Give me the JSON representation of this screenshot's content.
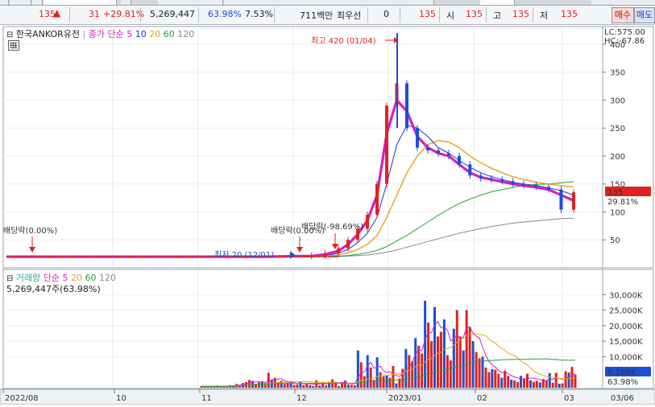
{
  "quote": {
    "price": "135",
    "change": "31",
    "change_pct": "+29.81%",
    "volume": "5,269,447",
    "volume_ratio": "63.98%",
    "turnover": "7.53%",
    "trade_value": "711백만",
    "best_bid_label": "최우선",
    "best_bid": "0",
    "ask_price": "135",
    "open_label": "시",
    "open": "135",
    "high_label": "고",
    "high": "135",
    "low_label": "저",
    "low": "135",
    "buy_label": "매수",
    "sell_label": "매도"
  },
  "price_panel": {
    "stock_name": "한국ANKOR유전",
    "ma_label": "종가 단순",
    "ma_periods": [
      "5",
      "10",
      "20",
      "60",
      "120"
    ],
    "lc": "LC:575.00",
    "hc": "HC:-67.86",
    "current_tag": "135",
    "current_pct": "29.81%",
    "annotations": {
      "high": "최고 420 (01/04)",
      "low": "최저 20 (12/01)",
      "dividend_1": "배당락(0.00%)",
      "dividend_2": "배당락(0.00%)",
      "dividend_3": "배당락(-98.69%)"
    }
  },
  "volume_panel": {
    "title": "거래량",
    "ma_label": "단순",
    "ma_periods": [
      "5",
      "20",
      "60",
      "120"
    ],
    "summary": "5,269,447주(63.98%)",
    "current_tag": "5,269K",
    "current_pct": "63.98%"
  },
  "x_axis_labels": [
    "2022/08",
    "10",
    "11",
    "12",
    "2023/01",
    "02",
    "03",
    "03/06"
  ],
  "colors": {
    "up": "#e0221e",
    "down": "#1a4fd6",
    "ma5": "#d21fc7",
    "ma10": "#1f33c9",
    "ma20": "#eaa21a",
    "ma60": "#27a33a",
    "ma120": "#8a8a8a"
  },
  "chart_data": [
    {
      "type": "line",
      "title": "한국ANKOR유전",
      "y_ticks": [
        50,
        100,
        150,
        200,
        250,
        300,
        350,
        400
      ],
      "ylim": [
        0,
        420
      ],
      "x_labels": [
        "2022/08",
        "10",
        "11",
        "12",
        "2023/01",
        "02",
        "03"
      ],
      "series": [
        {
          "name": "종가",
          "values": [
            20,
            20,
            20,
            20,
            20,
            20,
            20,
            20,
            20,
            21,
            22,
            26,
            35,
            50,
            70,
            95,
            150,
            290,
            330,
            250,
            215,
            210,
            205,
            200,
            185,
            165,
            160,
            158,
            155,
            150,
            148,
            145,
            140,
            104,
            135
          ]
        },
        {
          "name": "5",
          "values": [
            20,
            20,
            20,
            20,
            20,
            20,
            20,
            20,
            20,
            21,
            21,
            24,
            30,
            42,
            60,
            85,
            130,
            240,
            300,
            280,
            235,
            215,
            205,
            200,
            185,
            170,
            162,
            158,
            154,
            150,
            147,
            144,
            140,
            130,
            120
          ]
        },
        {
          "name": "10",
          "values": [
            20,
            20,
            20,
            20,
            20,
            20,
            20,
            20,
            20,
            20,
            21,
            22,
            26,
            33,
            45,
            62,
            90,
            150,
            220,
            255,
            250,
            235,
            215,
            205,
            192,
            180,
            170,
            163,
            158,
            153,
            150,
            147,
            143,
            138,
            130
          ]
        },
        {
          "name": "20",
          "values": [
            20,
            20,
            20,
            20,
            20,
            20,
            20,
            20,
            20,
            20,
            20,
            21,
            23,
            27,
            33,
            42,
            58,
            90,
            130,
            170,
            200,
            220,
            228,
            225,
            215,
            200,
            188,
            178,
            170,
            163,
            158,
            153,
            150,
            147,
            145
          ]
        },
        {
          "name": "60",
          "values": [
            20,
            20,
            20,
            20,
            20,
            20,
            20,
            20,
            20,
            20,
            20,
            20,
            21,
            22,
            24,
            27,
            31,
            38,
            48,
            58,
            70,
            82,
            94,
            105,
            115,
            123,
            130,
            136,
            140,
            144,
            147,
            149,
            150,
            152,
            154
          ]
        },
        {
          "name": "120",
          "values": [
            20,
            20,
            20,
            20,
            20,
            20,
            20,
            20,
            20,
            20,
            20,
            20,
            20,
            21,
            22,
            23,
            25,
            28,
            32,
            37,
            42,
            47,
            52,
            57,
            62,
            66,
            70,
            74,
            77,
            80,
            82,
            84,
            86,
            88,
            89
          ]
        }
      ]
    },
    {
      "type": "bar",
      "title": "거래량",
      "y_ticks": [
        "10,000K",
        "15,000K",
        "20,000K",
        "25,000K",
        "30,000K"
      ],
      "ylim": [
        0,
        35000
      ],
      "values": [
        500,
        400,
        600,
        350,
        300,
        700,
        400,
        500,
        650,
        800,
        600,
        1200,
        900,
        1500,
        1800,
        2500,
        2200,
        1300,
        1700,
        1900,
        1500,
        4800,
        2500,
        3200,
        1800,
        2200,
        1200,
        1600,
        2100,
        900,
        1100,
        2000,
        900,
        1300,
        800,
        600,
        2400,
        700,
        1600,
        800,
        1900,
        2700,
        1800,
        500,
        1400,
        2300,
        1000,
        900,
        800,
        12000,
        8200,
        3700,
        10500,
        6500,
        2500,
        9800,
        5000,
        3600,
        4000,
        3200,
        7000,
        1400,
        3000,
        6100,
        12500,
        10500,
        8500,
        16000,
        13500,
        11000,
        28000,
        21000,
        15000,
        26000,
        16500,
        18000,
        22000,
        10500,
        8800,
        19000,
        25000,
        16500,
        12000,
        25000,
        19500,
        15000,
        11500,
        9500,
        10000,
        6500,
        5000,
        6000,
        5800,
        4500,
        3200,
        5500,
        3800,
        2600,
        2300,
        1800,
        3800,
        3000,
        4500,
        2400,
        1900,
        2200,
        1700,
        2800,
        2400,
        4700,
        1600,
        4800,
        1300,
        1400,
        5300,
        4900,
        6700,
        4200
      ]
    }
  ]
}
